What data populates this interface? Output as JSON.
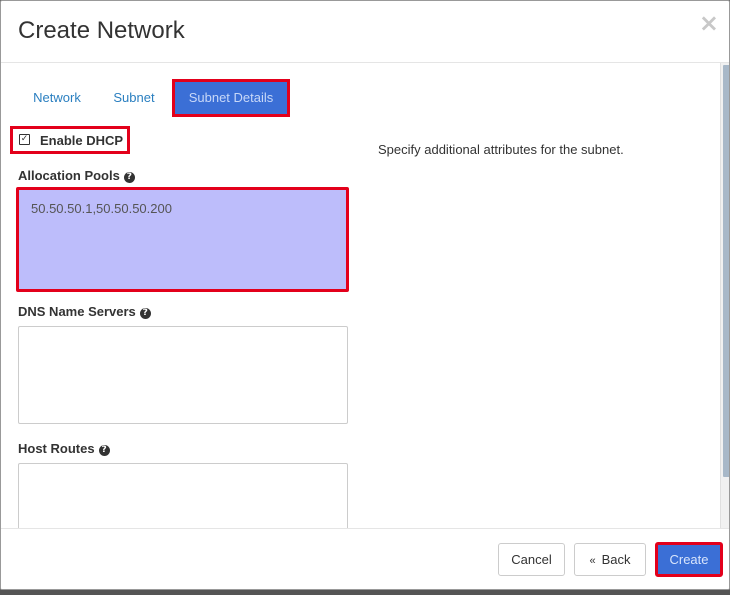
{
  "modal": {
    "title": "Create Network",
    "close_glyph": "×"
  },
  "tabs": [
    {
      "label": "Network"
    },
    {
      "label": "Subnet"
    },
    {
      "label": "Subnet Details",
      "active": true
    }
  ],
  "form": {
    "enable_dhcp": {
      "label": "Enable DHCP",
      "checked": true
    },
    "allocation_pools": {
      "label": "Allocation Pools",
      "value": "50.50.50.1,50.50.50.200"
    },
    "dns_name_servers": {
      "label": "DNS Name Servers",
      "value": ""
    },
    "host_routes": {
      "label": "Host Routes",
      "value": ""
    }
  },
  "help_text": "Specify additional attributes for the subnet.",
  "footer": {
    "cancel_label": "Cancel",
    "back_label": "Back",
    "back_glyph": "«",
    "create_label": "Create"
  },
  "colors": {
    "accent": "#3b6fd6",
    "highlight_border": "#e3001b",
    "selected_textarea": "#bdbdfb",
    "link": "#2a7fc0"
  },
  "icons": [
    "close-icon",
    "checkbox-checked-icon",
    "help-icon"
  ]
}
